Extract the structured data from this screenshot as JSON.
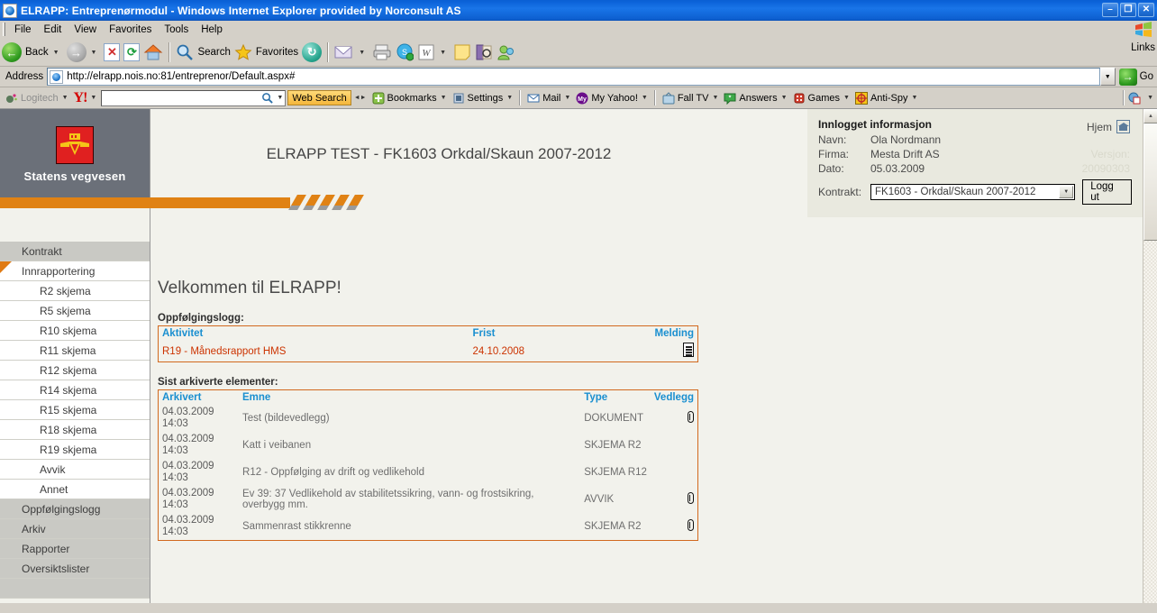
{
  "window": {
    "title": "ELRAPP: Entreprenørmodul - Windows Internet Explorer provided by Norconsult AS",
    "icon": "ie-page-icon",
    "minimize": "–",
    "maximize": "❐",
    "close": "✕"
  },
  "menubar": {
    "items": [
      {
        "label": "File",
        "name": "menu-file"
      },
      {
        "label": "Edit",
        "name": "menu-edit"
      },
      {
        "label": "View",
        "name": "menu-view"
      },
      {
        "label": "Favorites",
        "name": "menu-favorites"
      },
      {
        "label": "Tools",
        "name": "menu-tools"
      },
      {
        "label": "Help",
        "name": "menu-help"
      }
    ]
  },
  "toolbar": {
    "back_label": "Back",
    "search_label": "Search",
    "favorites_label": "Favorites",
    "links_label": "Links"
  },
  "address": {
    "label": "Address",
    "url": "http://elrapp.nois.no:81/entreprenor/Default.aspx#",
    "go_label": "Go"
  },
  "yahoo_toolbar": {
    "logitech_label": "Logitech",
    "brand": "Y!",
    "search_value": "",
    "web_search_label": "Web Search",
    "items": [
      {
        "label": "Bookmarks",
        "name": "yahoo-bookmarks"
      },
      {
        "label": "Settings",
        "name": "yahoo-settings"
      },
      {
        "label": "Mail",
        "name": "yahoo-mail"
      },
      {
        "label": "My Yahoo!",
        "name": "yahoo-my-yahoo"
      },
      {
        "label": "Fall TV",
        "name": "yahoo-fall-tv"
      },
      {
        "label": "Answers",
        "name": "yahoo-answers"
      },
      {
        "label": "Games",
        "name": "yahoo-games"
      },
      {
        "label": "Anti-Spy",
        "name": "yahoo-anti-spy"
      }
    ]
  },
  "brand": {
    "name": "Statens vegvesen",
    "shield_color": "#e02020",
    "emblem_color": "#f5c518",
    "accent_color": "#e08214"
  },
  "sidebar": {
    "items": [
      {
        "label": "Kontrakt",
        "level": "top",
        "selected": false,
        "name": "sidebar-item-kontrakt"
      },
      {
        "label": "Innrapportering",
        "level": "cur",
        "selected": true,
        "name": "sidebar-item-innrapportering"
      },
      {
        "label": "R2 skjema",
        "level": "sub",
        "selected": false,
        "name": "sidebar-item-r2-skjema"
      },
      {
        "label": "R5 skjema",
        "level": "sub",
        "selected": false,
        "name": "sidebar-item-r5-skjema"
      },
      {
        "label": "R10 skjema",
        "level": "sub",
        "selected": false,
        "name": "sidebar-item-r10-skjema"
      },
      {
        "label": "R11 skjema",
        "level": "sub",
        "selected": false,
        "name": "sidebar-item-r11-skjema"
      },
      {
        "label": "R12 skjema",
        "level": "sub",
        "selected": false,
        "name": "sidebar-item-r12-skjema"
      },
      {
        "label": "R14 skjema",
        "level": "sub",
        "selected": false,
        "name": "sidebar-item-r14-skjema"
      },
      {
        "label": "R15 skjema",
        "level": "sub",
        "selected": false,
        "name": "sidebar-item-r15-skjema"
      },
      {
        "label": "R18 skjema",
        "level": "sub",
        "selected": false,
        "name": "sidebar-item-r18-skjema"
      },
      {
        "label": "R19 skjema",
        "level": "sub",
        "selected": false,
        "name": "sidebar-item-r19-skjema"
      },
      {
        "label": "Avvik",
        "level": "sub",
        "selected": false,
        "name": "sidebar-item-avvik"
      },
      {
        "label": "Annet",
        "level": "sub",
        "selected": false,
        "name": "sidebar-item-annet"
      },
      {
        "label": "Oppfølgingslogg",
        "level": "top",
        "selected": false,
        "name": "sidebar-item-oppfolgingslogg"
      },
      {
        "label": "Arkiv",
        "level": "top",
        "selected": false,
        "name": "sidebar-item-arkiv"
      },
      {
        "label": "Rapporter",
        "level": "top",
        "selected": false,
        "name": "sidebar-item-rapporter"
      },
      {
        "label": "Oversiktslister",
        "level": "top",
        "selected": false,
        "name": "sidebar-item-oversiktslister"
      }
    ]
  },
  "header": {
    "banner_title": "ELRAPP TEST - FK1603 Orkdal/Skaun 2007-2012"
  },
  "loginbox": {
    "title": "Innlogget informasjon",
    "navn_label": "Navn:",
    "navn_value": "Ola Nordmann",
    "firma_label": "Firma:",
    "firma_value": "Mesta Drift AS",
    "dato_label": "Dato:",
    "dato_value": "05.03.2009",
    "kontrakt_label": "Kontrakt:",
    "kontrakt_value": "FK1603 - Orkdal/Skaun 2007-2012",
    "logout_label": "Logg ut",
    "hjem_label": "Hjem",
    "version_label": "Versjon:",
    "version_value": "20090303"
  },
  "main": {
    "welcome": "Velkommen til ELRAPP!",
    "oppfolgingslogg": {
      "caption": "Oppfølgingslogg:",
      "columns": [
        "Aktivitet",
        "Frist",
        "Melding"
      ],
      "rows": [
        {
          "aktivitet": "R19 - Månedsrapport HMS",
          "frist": "24.10.2008",
          "melding": "message-icon"
        }
      ]
    },
    "arkiv": {
      "caption": "Sist arkiverte elementer:",
      "columns": [
        "Arkivert",
        "Emne",
        "Type",
        "Vedlegg"
      ],
      "rows": [
        {
          "dato": "04.03.2009",
          "tid": "14:03",
          "emne": "Test (bildevedlegg)",
          "type": "DOKUMENT",
          "vedlegg": true
        },
        {
          "dato": "04.03.2009",
          "tid": "14:03",
          "emne": "Katt i veibanen",
          "type": "SKJEMA R2",
          "vedlegg": false
        },
        {
          "dato": "04.03.2009",
          "tid": "14:03",
          "emne": "R12 - Oppfølging av drift og vedlikehold",
          "type": "SKJEMA R12",
          "vedlegg": false
        },
        {
          "dato": "04.03.2009",
          "tid": "14:03",
          "emne": "Ev 39: 37 Vedlikehold av stabilitetssikring, vann- og frostsikring, overbygg mm.",
          "type": "AVVIK",
          "vedlegg": true
        },
        {
          "dato": "04.03.2009",
          "tid": "14:03",
          "emne": "Sammenrast stikkrenne",
          "type": "SKJEMA R2",
          "vedlegg": true
        }
      ]
    }
  }
}
